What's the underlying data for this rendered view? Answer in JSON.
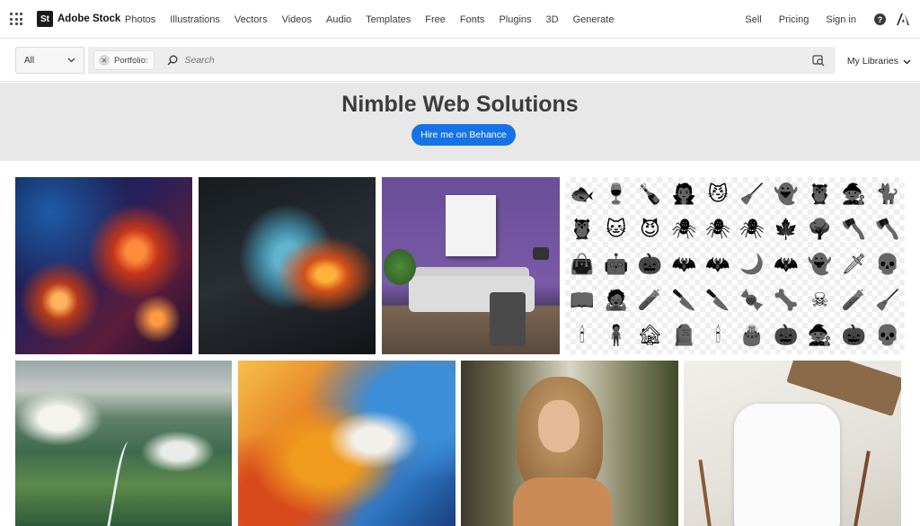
{
  "brand": {
    "badge": "St",
    "name": "Adobe Stock"
  },
  "nav": {
    "items": [
      "Photos",
      "Illustrations",
      "Vectors",
      "Videos",
      "Audio",
      "Templates",
      "Free",
      "Fonts",
      "Plugins",
      "3D",
      "Generate"
    ],
    "sell": "Sell",
    "pricing": "Pricing",
    "signin": "Sign in",
    "help_icon": "question-circle-icon",
    "adobe_icon": "adobe-logo-icon"
  },
  "search": {
    "filter_value": "All",
    "chip_label": "Portfolio:",
    "placeholder": "Search",
    "libraries": "My Libraries"
  },
  "banner": {
    "title": "Nimble Web Solutions",
    "button": "Hire me on Behance"
  },
  "colors": {
    "accent": "#1473e6",
    "banner_bg": "#e8e8e8"
  },
  "gallery": {
    "row1": [
      "neurons-image",
      "shattered-face-image",
      "purple-room-image",
      "halloween-icons-image"
    ],
    "row2": [
      "mountain-valley-image",
      "abstract-paint-image",
      "woman-smiling-image",
      "baby-onesie-image"
    ],
    "icon_glyphs": [
      "🐟",
      "🍷",
      "🍾",
      "🧛",
      "😼",
      "🧹",
      "👻",
      "🦉",
      "🧙",
      "🐈",
      "🦉",
      "🐱",
      "😈",
      "🕷",
      "🕷",
      "🕷",
      "🍁",
      "🌳",
      "🪓",
      "🪓",
      "👜",
      "🤖",
      "🎃",
      "🦇",
      "🦇",
      "🌙",
      "🦇",
      "👻",
      "🗡",
      "💀",
      "📖",
      "🧟",
      "🧪",
      "🔪",
      "🔪",
      "🍬",
      "🦴",
      "☠",
      "🧪",
      "🧹",
      "🕯",
      "🧍",
      "🏚",
      "🪦",
      "🕯",
      "🎂",
      "🎃",
      "🧙",
      "🎃",
      "💀"
    ]
  }
}
